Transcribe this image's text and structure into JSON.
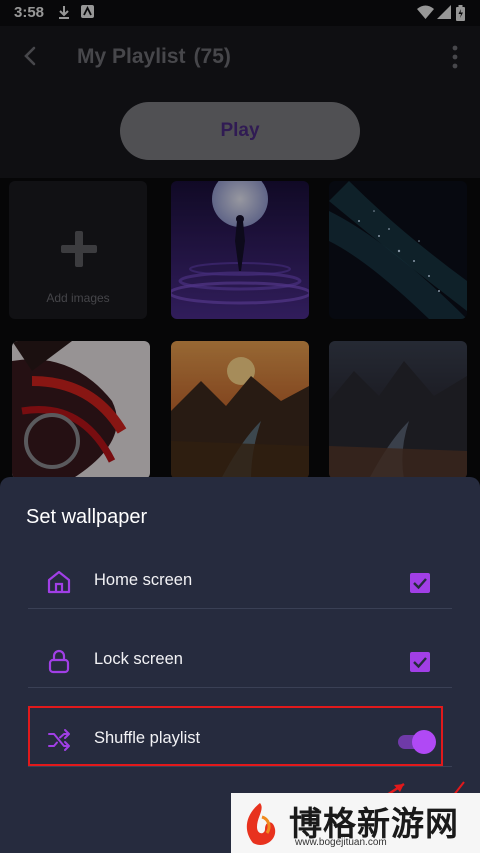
{
  "status_bar": {
    "time": "3:58",
    "icons": [
      "download-icon",
      "notification-icon",
      "wifi-icon",
      "signal-icon",
      "battery-icon"
    ]
  },
  "app_bar": {
    "title": "My Playlist",
    "count": "(75)"
  },
  "play_button": {
    "label": "Play"
  },
  "grid": {
    "add_label": "Add images",
    "images": [
      "wallpaper-moon-figure",
      "wallpaper-starfield",
      "wallpaper-abstract-red",
      "wallpaper-sunset-mountains",
      "wallpaper-night-mountains"
    ]
  },
  "sheet": {
    "title": "Set wallpaper",
    "options": [
      {
        "label": "Home screen",
        "icon": "home-icon",
        "control": "checkbox",
        "checked": true
      },
      {
        "label": "Lock screen",
        "icon": "lock-icon",
        "control": "checkbox",
        "checked": true
      },
      {
        "label": "Shuffle playlist",
        "icon": "shuffle-icon",
        "control": "toggle",
        "on": true
      }
    ]
  },
  "watermark": {
    "text": "博格新游网",
    "url": "www.bogejituan.com"
  },
  "colors": {
    "accent": "#A13FE6",
    "sheet_bg": "#262B3E",
    "highlight": "#E1191B"
  }
}
